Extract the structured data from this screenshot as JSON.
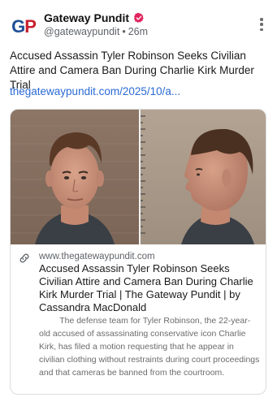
{
  "post": {
    "display_name": "Gateway Pundit",
    "handle": "@gatewaypundit",
    "separator": "•",
    "timestamp": "26m",
    "text": "Accused Assassin Tyler Robinson Seeks Civilian Attire and Camera Ban During Charlie Kirk Murder Trial",
    "link_text": "thegatewaypundit.com/2025/10/a..."
  },
  "avatar": {
    "logo_g": "G",
    "logo_p": "P"
  },
  "card": {
    "domain": "www.thegatewaypundit.com",
    "title": "Accused Assassin Tyler Robinson Seeks Civilian Attire and Camera Ban During Charlie Kirk Murder Trial | The Gateway Pundit | by Cassandra MacDonald",
    "description": "The defense team for Tyler Robinson, the 22-year-old accused of assassinating conservative icon Charlie Kirk, has filed a motion requesting that he appear in civilian clothing without restraints during court proceedings and that cameras be banned from the courtroom."
  },
  "icons": {
    "verified": "verified-badge-icon",
    "more": "more-vertical-icon",
    "link": "link-icon"
  },
  "colors": {
    "link": "#2a6ad6",
    "verified": "#e0245e",
    "logo_blue": "#1f4f96",
    "logo_red": "#c8202f"
  }
}
